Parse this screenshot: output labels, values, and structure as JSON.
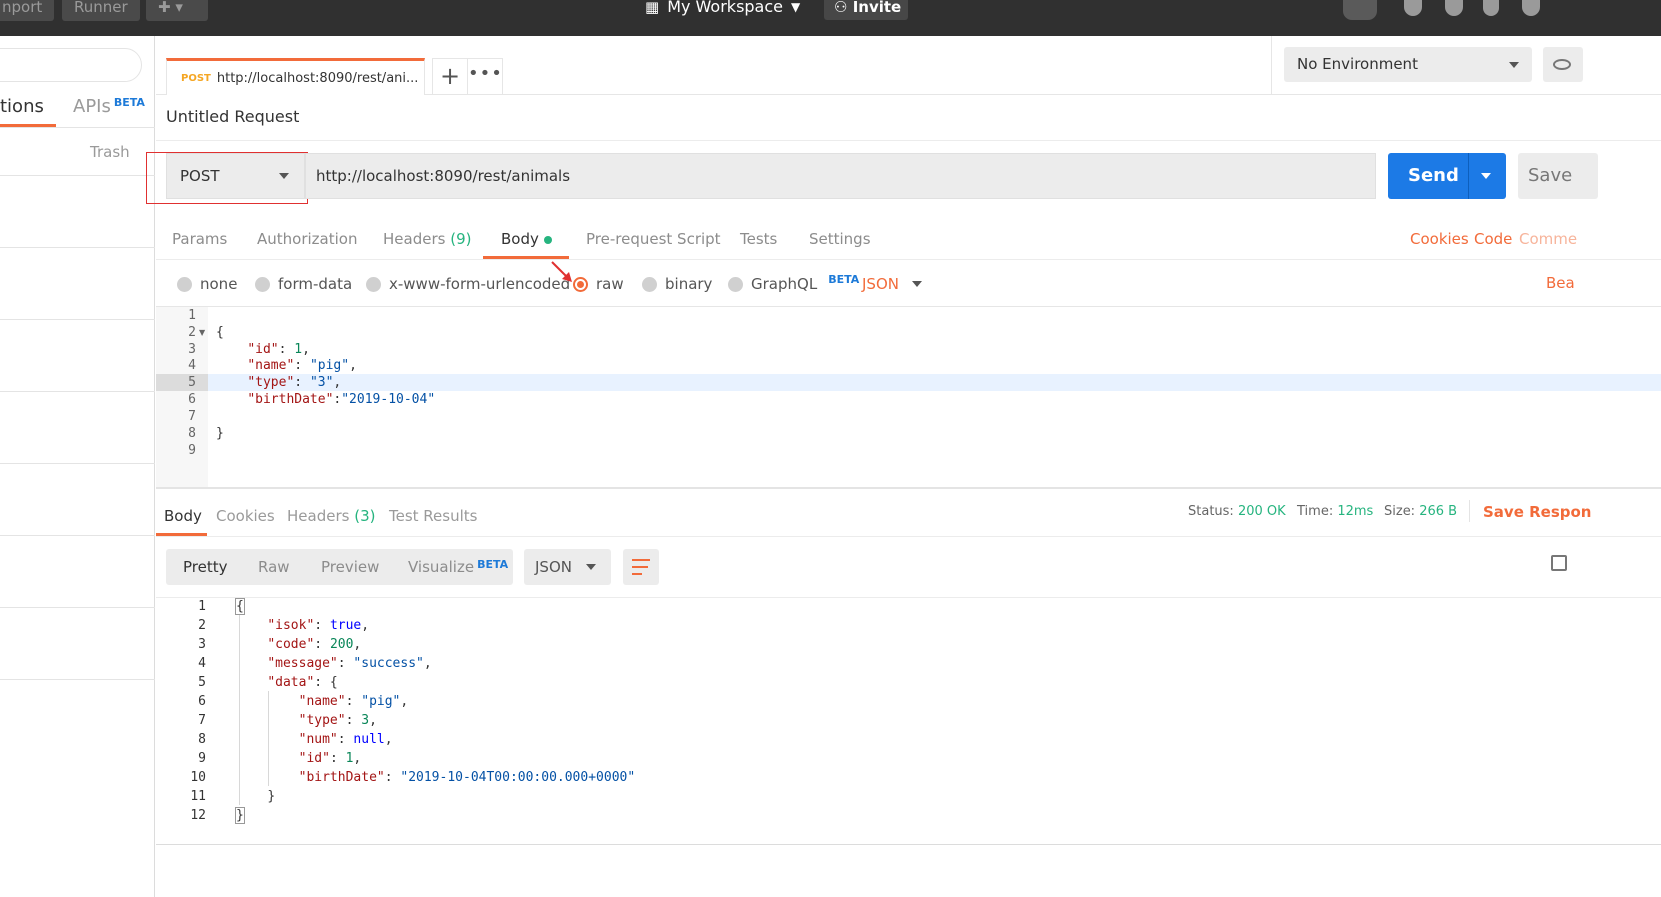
{
  "header": {
    "import_label": "nport",
    "runner_label": "Runner",
    "workspace_label": "My Workspace",
    "invite_label": "Invite"
  },
  "sidebar": {
    "tab_collections": "tions",
    "tab_apis": "APIs",
    "apis_badge": "BETA",
    "trash_label": "Trash"
  },
  "tabs": {
    "active_method": "POST",
    "active_title": "http://localhost:8090/rest/ani...",
    "add_label": "+",
    "more_label": "•••"
  },
  "environment": {
    "selected": "No Environment"
  },
  "request": {
    "title": "Untitled Request",
    "method": "POST",
    "url": "http://localhost:8090/rest/animals",
    "send_label": "Send",
    "save_label": "Save",
    "subtabs": {
      "params": "Params",
      "authorization": "Authorization",
      "headers": "Headers",
      "headers_count": "(9)",
      "body": "Body",
      "prerequest": "Pre-request Script",
      "tests": "Tests",
      "settings": "Settings"
    },
    "links": {
      "cookies": "Cookies",
      "code": "Code",
      "comments": "Comme"
    },
    "body_types": {
      "none": "none",
      "form_data": "form-data",
      "urlencoded": "x-www-form-urlencoded",
      "raw": "raw",
      "binary": "binary",
      "graphql": "GraphQL",
      "graphql_badge": "BETA",
      "format": "JSON",
      "beautify": "Bea"
    },
    "body_lines": {
      "n1": "1",
      "n2": "2",
      "n3": "3",
      "n4": "4",
      "n5": "5",
      "n6": "6",
      "n7": "7",
      "n8": "8",
      "n9": "9",
      "l2": "{",
      "l3_key": "\"id\"",
      "l3_val": "1",
      "l4_key": "\"name\"",
      "l4_val": "\"pig\"",
      "l5_key": "\"type\"",
      "l5_val": "\"3\"",
      "l6_key": "\"birthDate\"",
      "l6_val": "\"2019-10-04\"",
      "l8": "}"
    }
  },
  "response": {
    "tabs": {
      "body": "Body",
      "cookies": "Cookies",
      "headers": "Headers",
      "headers_count": "(3)",
      "test_results": "Test Results"
    },
    "status_label": "Status:",
    "status_value": "200 OK",
    "time_label": "Time:",
    "time_value": "12ms",
    "size_label": "Size:",
    "size_value": "266 B",
    "save_label": "Save Respon",
    "view_modes": {
      "pretty": "Pretty",
      "raw": "Raw",
      "preview": "Preview",
      "visualize": "Visualize",
      "visualize_badge": "BETA"
    },
    "format": "JSON",
    "lines": {
      "n1": "1",
      "n2": "2",
      "n3": "3",
      "n4": "4",
      "n5": "5",
      "n6": "6",
      "n7": "7",
      "n8": "8",
      "n9": "9",
      "n10": "10",
      "n11": "11",
      "n12": "12",
      "l1": "{",
      "isok_key": "\"isok\"",
      "isok_val": "true",
      "code_key": "\"code\"",
      "code_val": "200",
      "message_key": "\"message\"",
      "message_val": "\"success\"",
      "data_key": "\"data\"",
      "name_key": "\"name\"",
      "name_val": "\"pig\"",
      "type_key": "\"type\"",
      "type_val": "3",
      "num_key": "\"num\"",
      "num_val": "null",
      "id_key": "\"id\"",
      "id_val": "1",
      "birth_key": "\"birthDate\"",
      "birth_val": "\"2019-10-04T00:00:00.000+0000\"",
      "l11": "}",
      "l12": "}"
    }
  }
}
